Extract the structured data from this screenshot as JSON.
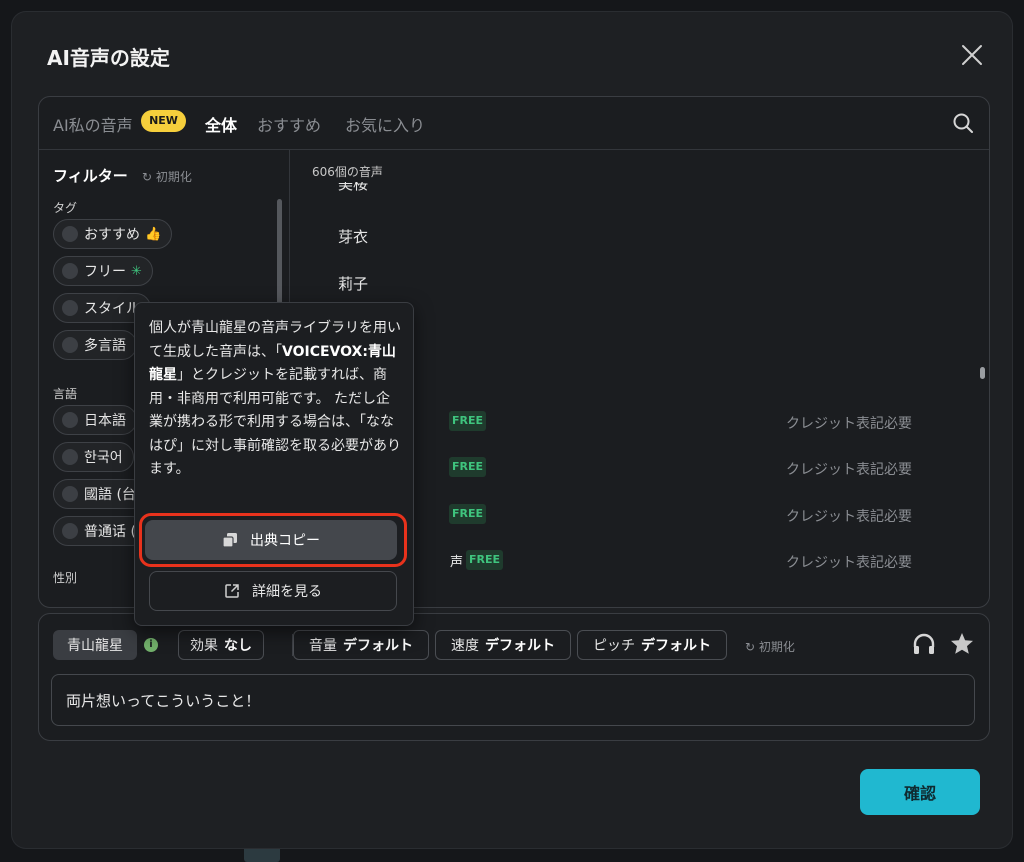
{
  "modal": {
    "title": "AI音声の設定"
  },
  "tabs": {
    "items": [
      {
        "label": "AI私の音声"
      },
      {
        "label": "全体"
      },
      {
        "label": "おすすめ"
      },
      {
        "label": "お気に入り"
      }
    ],
    "new_badge": "NEW",
    "active": "全体"
  },
  "sidebar": {
    "title": "フィルター",
    "reset": "初期化",
    "sections": {
      "tag": "タグ",
      "language": "言語",
      "gender": "性別"
    },
    "tags": [
      {
        "label": "おすすめ"
      },
      {
        "label": "フリー"
      },
      {
        "label": "スタイル"
      },
      {
        "label": "多言語"
      }
    ],
    "languages": [
      {
        "label": "日本語"
      },
      {
        "label": "한국어"
      },
      {
        "label": "國語 (台"
      },
      {
        "label": "普通话 ("
      }
    ]
  },
  "list": {
    "count": "606個の音声",
    "names": [
      "美桜",
      "芽衣",
      "莉子"
    ],
    "free_label": "FREE",
    "partial_name": "声",
    "credits": [
      "クレジット表記必要",
      "クレジット表記必要",
      "クレジット表記必要",
      "クレジット表記必要"
    ]
  },
  "popover": {
    "text_1": "個人が青山龍星の音声ライブラリを用いて生成した音声は、「",
    "text_bold": "VOICEVOX:青山龍星",
    "text_2": "」とクレジットを記載すれば、商用・非商用で利用可能です。 ただし企業が携わる形で利用する場合は、「ななはぴ」に対し事前確認を取る必要があります。",
    "copy_button": "出典コピー",
    "detail_button": "詳細を見る"
  },
  "player": {
    "voice": "青山龍星",
    "info": "i",
    "effect": {
      "label": "効果",
      "value": "なし"
    },
    "volume": {
      "label": "音量",
      "value": "デフォルト"
    },
    "speed": {
      "label": "速度",
      "value": "デフォルト"
    },
    "pitch": {
      "label": "ピッチ",
      "value": "デフォルト"
    },
    "reset": "初期化",
    "text": "両片想いってこういうこと！"
  },
  "footer": {
    "confirm": "確認"
  },
  "colors": {
    "accent": "#20b8d0",
    "highlight": "#e8321c",
    "free": "#3fc47e",
    "new_badge": "#f6cf3c"
  }
}
